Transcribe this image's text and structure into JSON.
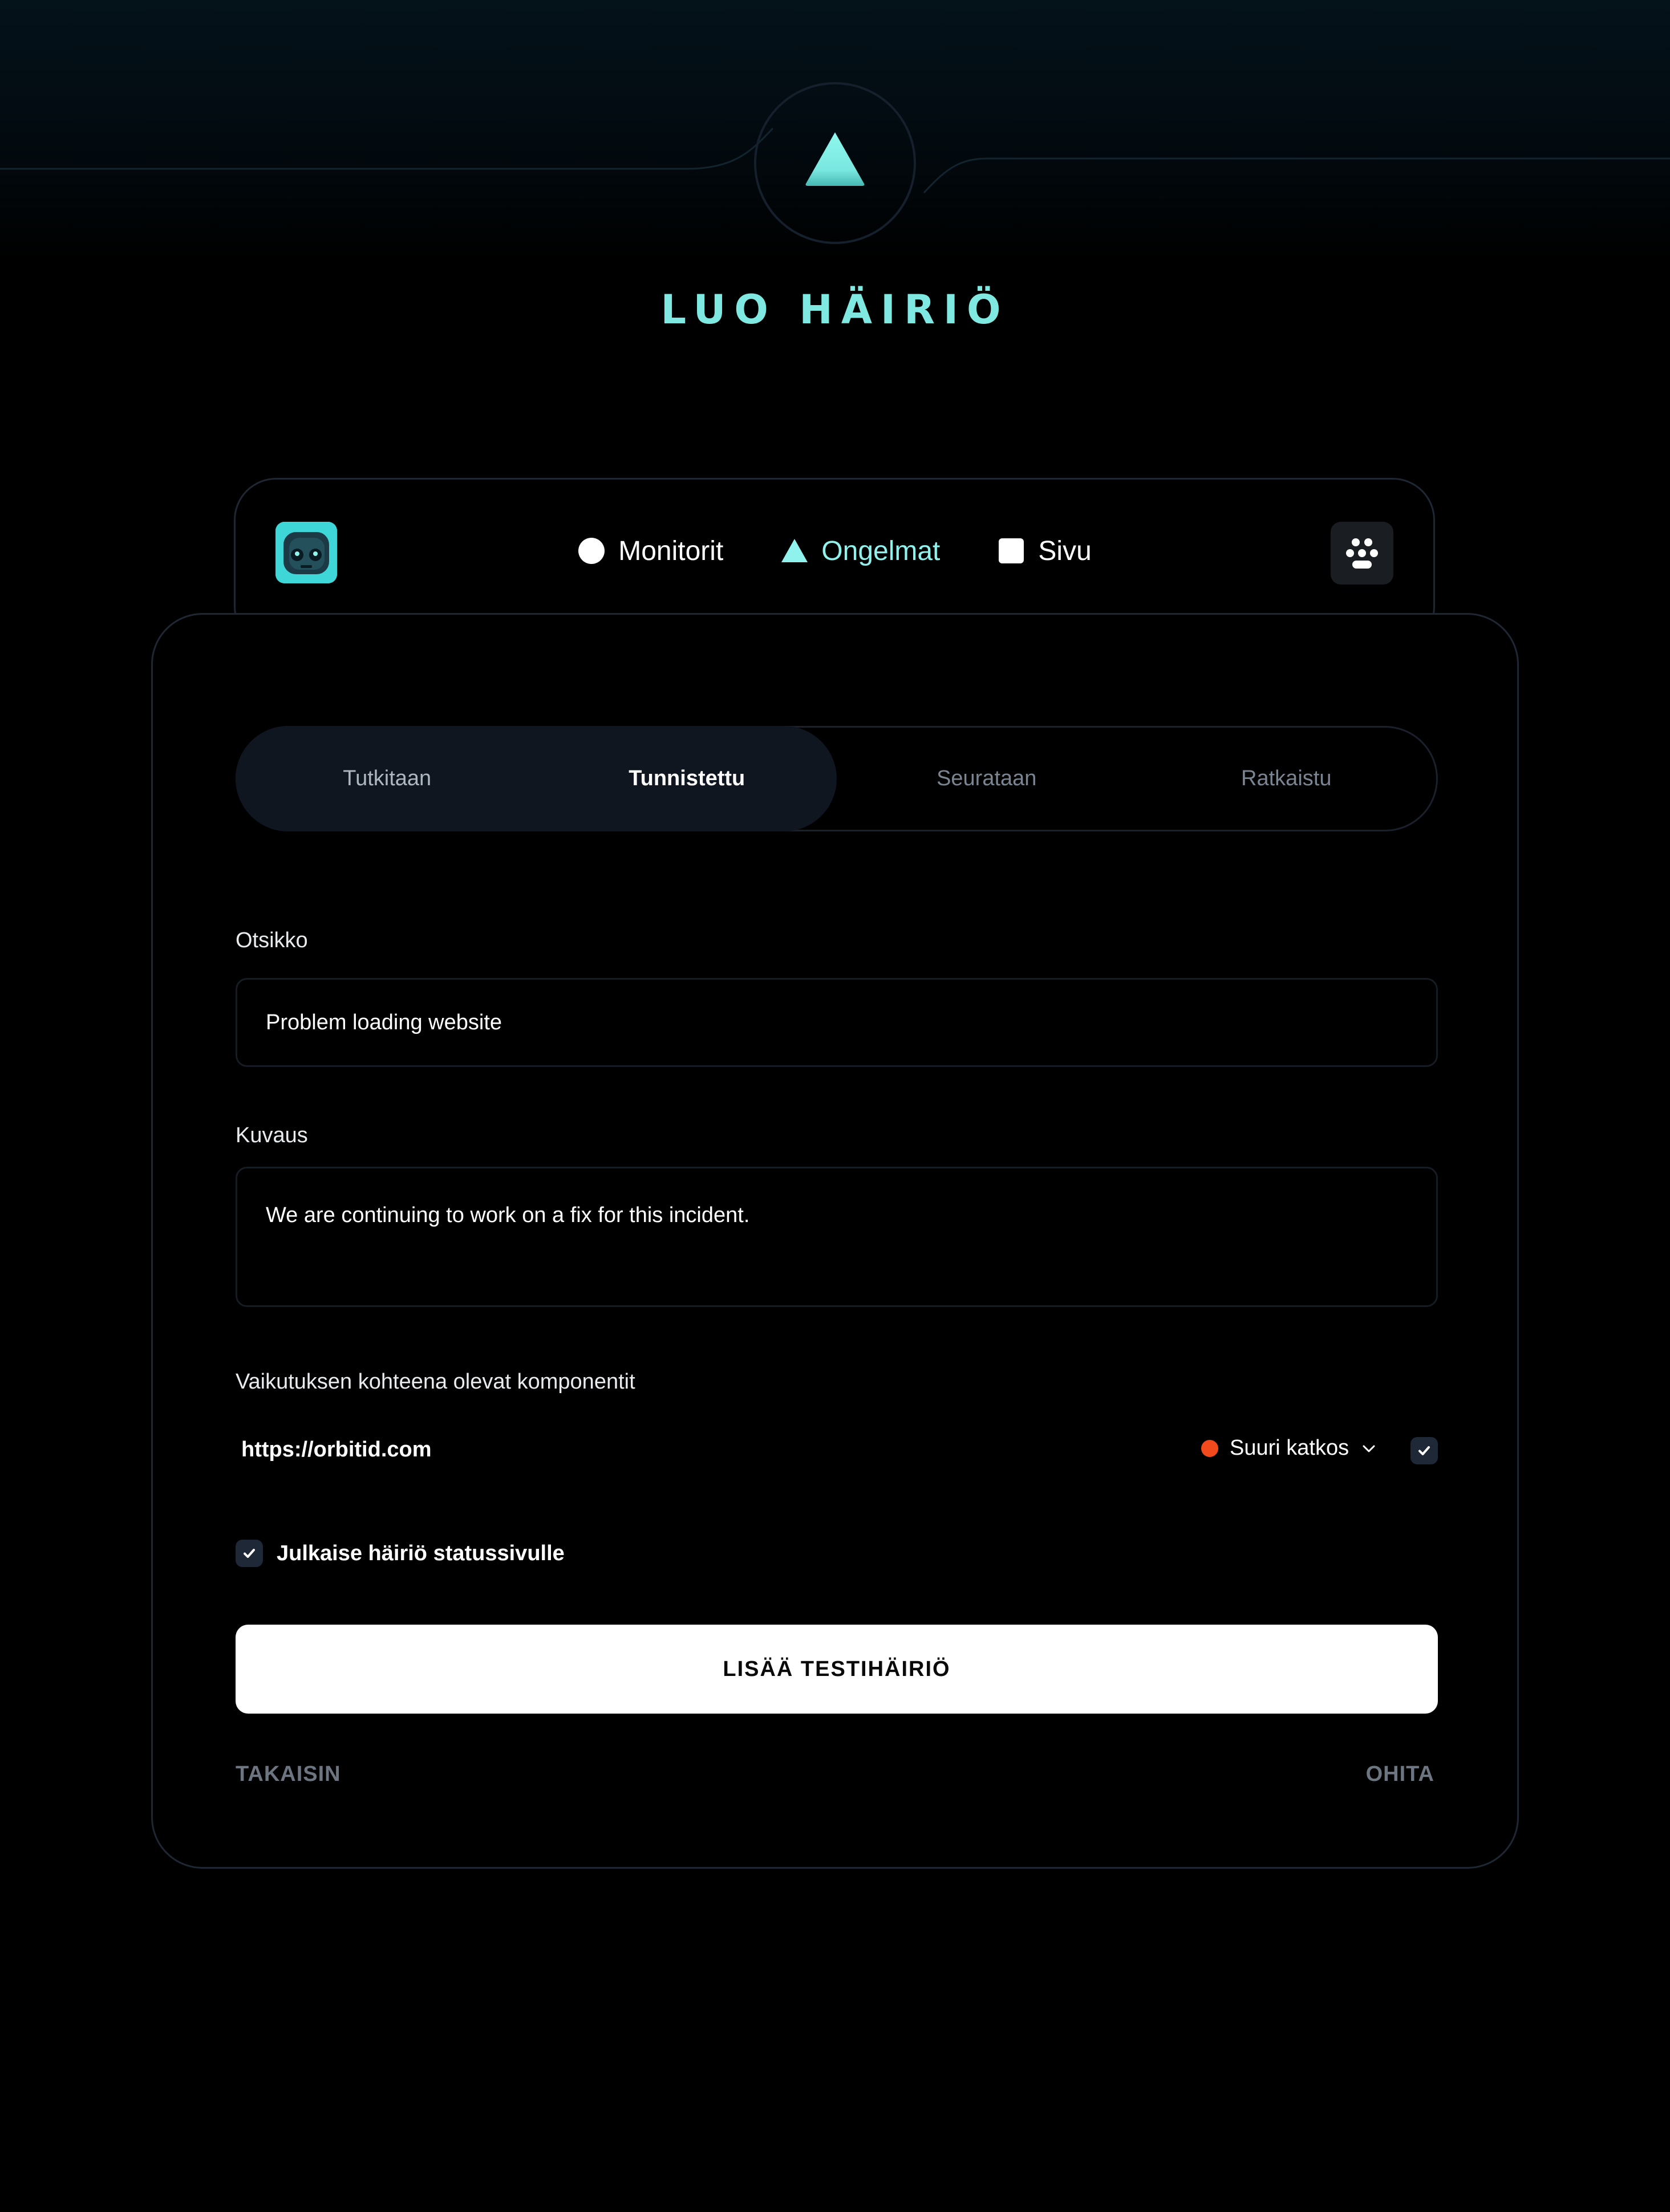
{
  "page": {
    "title": "LUO HÄIRIÖ"
  },
  "nav": {
    "items": [
      {
        "label": "Monitorit",
        "icon": "circle-icon",
        "active": false
      },
      {
        "label": "Ongelmat",
        "icon": "triangle-icon",
        "active": true
      },
      {
        "label": "Sivu",
        "icon": "square-icon",
        "active": false
      }
    ],
    "accent": "#8ff2ec"
  },
  "status_tabs": [
    {
      "label": "Tutkitaan",
      "selected": false
    },
    {
      "label": "Tunnistettu",
      "selected": true
    },
    {
      "label": "Seurataan",
      "selected": false
    },
    {
      "label": "Ratkaistu",
      "selected": false
    }
  ],
  "form": {
    "title_label": "Otsikko",
    "title_value": "Problem loading website",
    "description_label": "Kuvaus",
    "description_value": "We are continuing to work on a fix for this incident.",
    "components_label": "Vaikutuksen kohteena olevat komponentit",
    "component": {
      "url": "https://orbitid.com",
      "status": "Suuri katkos",
      "status_color": "#f24a1d",
      "checked": true
    },
    "publish_label": "Julkaise häiriö statussivulle",
    "publish_checked": true
  },
  "actions": {
    "primary": "LISÄÄ TESTIHÄIRIÖ",
    "back": "TAKAISIN",
    "skip": "OHITA"
  }
}
